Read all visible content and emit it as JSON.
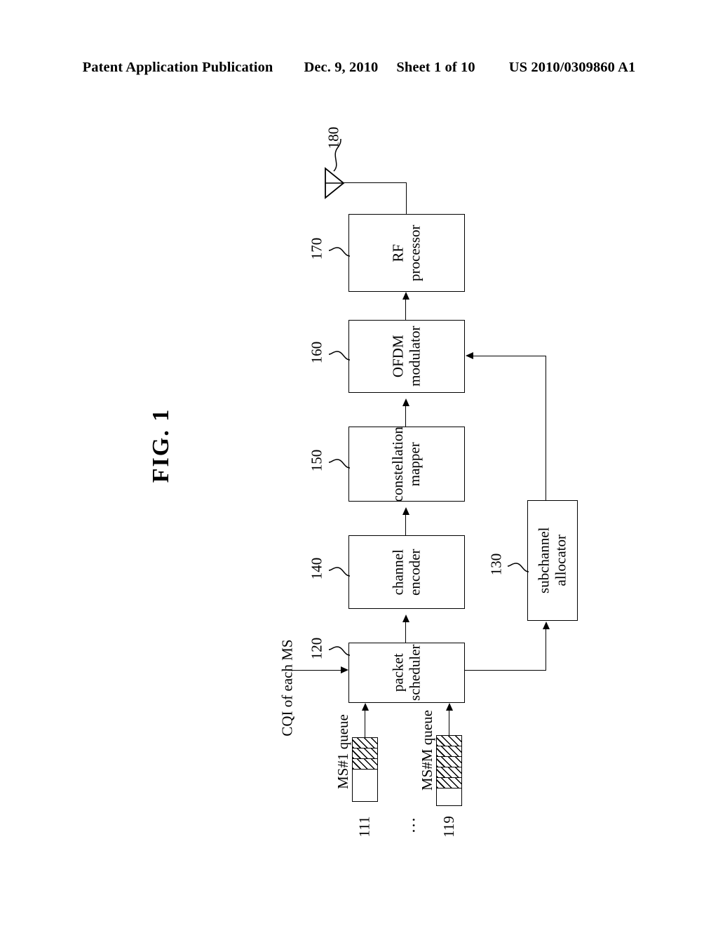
{
  "header": {
    "publication": "Patent Application Publication",
    "date": "Dec. 9, 2010",
    "sheet": "Sheet 1 of 10",
    "patent_number": "US 2010/0309860 A1"
  },
  "figure": {
    "title": "FIG. 1",
    "blocks": [
      {
        "ref": "170",
        "label_line1": "RF",
        "label_line2": "processor"
      },
      {
        "ref": "160",
        "label_line1": "OFDM",
        "label_line2": "modulator"
      },
      {
        "ref": "150",
        "label_line1": "constellation",
        "label_line2": "mapper"
      },
      {
        "ref": "140",
        "label_line1": "channel",
        "label_line2": "encoder"
      },
      {
        "ref": "120",
        "label_line1": "packet",
        "label_line2": "scheduler"
      },
      {
        "ref": "130",
        "label_line1": "subchannel",
        "label_line2": "allocator"
      }
    ],
    "antenna": {
      "ref": "180",
      "name": "antenna"
    },
    "input_label": "CQI of each MS",
    "queues": [
      {
        "ref": "111",
        "label": "MS#1 queue",
        "cells": 4,
        "filled": 3
      },
      {
        "ref": "119",
        "label": "MS#M queue",
        "cells": 6,
        "filled": 5
      }
    ],
    "ellipsis": "...",
    "line_color": "#000000"
  }
}
